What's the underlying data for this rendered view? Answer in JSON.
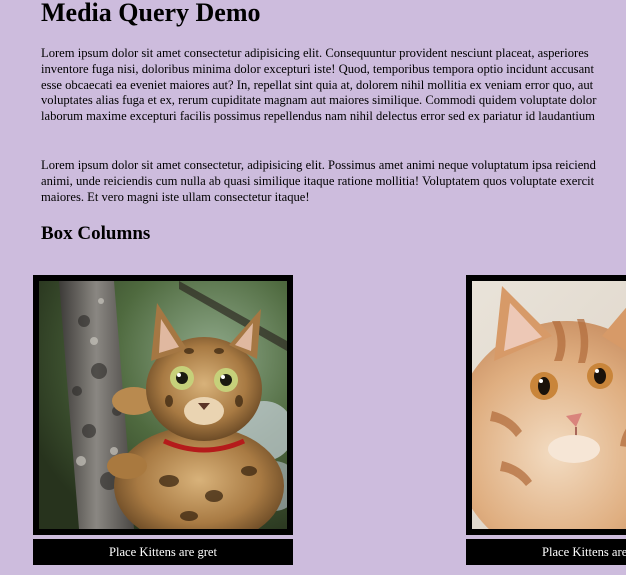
{
  "page": {
    "title": "Media Query Demo",
    "paragraph1_lines": [
      "Lorem ipsum dolor sit amet consectetur adipisicing elit. Consequuntur provident nesciunt placeat, asperiores",
      "inventore fuga nisi, doloribus minima dolor excepturi iste! Quod, temporibus tempora optio incidunt accusant",
      "esse obcaecati ea eveniet maiores aut? In, repellat sint quia at, dolorem nihil mollitia ex veniam error quo, aut",
      "voluptates alias fuga et ex, rerum cupiditate magnam aut maiores similique. Commodi quidem voluptate dolor",
      "laborum maxime excepturi facilis possimus repellendus nam nihil delectus error sed ex pariatur id laudantium"
    ],
    "paragraph2_lines": [
      "Lorem ipsum dolor sit amet consectetur, adipisicing elit. Possimus amet animi neque voluptatum ipsa reiciend",
      "animi, unde reiciendis cum nulla ab quasi similique itaque ratione mollitia! Voluptatem quos voluptate exercit",
      "maiores. Et vero magni iste ullam consectetur itaque!"
    ],
    "section_heading": "Box Columns"
  },
  "cards": [
    {
      "caption": "Place Kittens are gret",
      "image": "bengal-kitten-climbing-tree"
    },
    {
      "caption": "Place Kittens are gret",
      "image": "orange-tabby-kitten-face"
    }
  ],
  "colors": {
    "background": "#cdbcdd",
    "frame": "#000000",
    "caption_bg": "#000000",
    "caption_text": "#ffffff"
  }
}
